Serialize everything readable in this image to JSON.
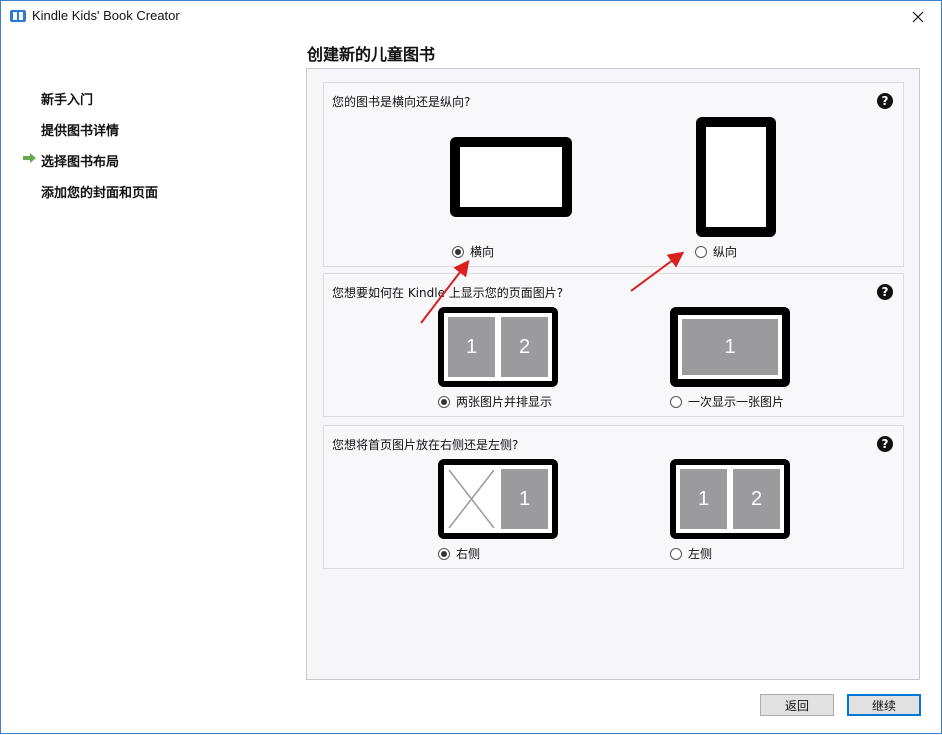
{
  "window": {
    "title": "Kindle Kids' Book Creator"
  },
  "nav": {
    "items": [
      {
        "label": "新手入门"
      },
      {
        "label": "提供图书详情"
      },
      {
        "label": "选择图书布局"
      },
      {
        "label": "添加您的封面和页面"
      }
    ],
    "active_index": 2
  },
  "page_title": "创建新的儿童图书",
  "sections": {
    "orientation": {
      "question": "您的图书是横向还是纵向?",
      "options": [
        {
          "label": "横向",
          "selected": true
        },
        {
          "label": "纵向",
          "selected": false
        }
      ]
    },
    "display": {
      "question": "您想要如何在 Kindle 上显示您的页面图片?",
      "options": [
        {
          "label": "两张图片并排显示",
          "selected": true
        },
        {
          "label": "一次显示一张图片",
          "selected": false
        }
      ],
      "page_numbers": [
        "1",
        "2",
        "1"
      ]
    },
    "first_page": {
      "question": "您想将首页图片放在右侧还是左侧?",
      "options": [
        {
          "label": "右侧",
          "selected": true
        },
        {
          "label": "左侧",
          "selected": false
        }
      ],
      "page_numbers": [
        "1",
        "1",
        "2"
      ]
    }
  },
  "buttons": {
    "back": "返回",
    "next": "继续"
  },
  "help_glyph": "?",
  "colors": {
    "accent": "#0078d7",
    "arrow": "#d9201f",
    "page_fill": "#9b9a9c",
    "nav_arrow": "#6aa84f"
  }
}
